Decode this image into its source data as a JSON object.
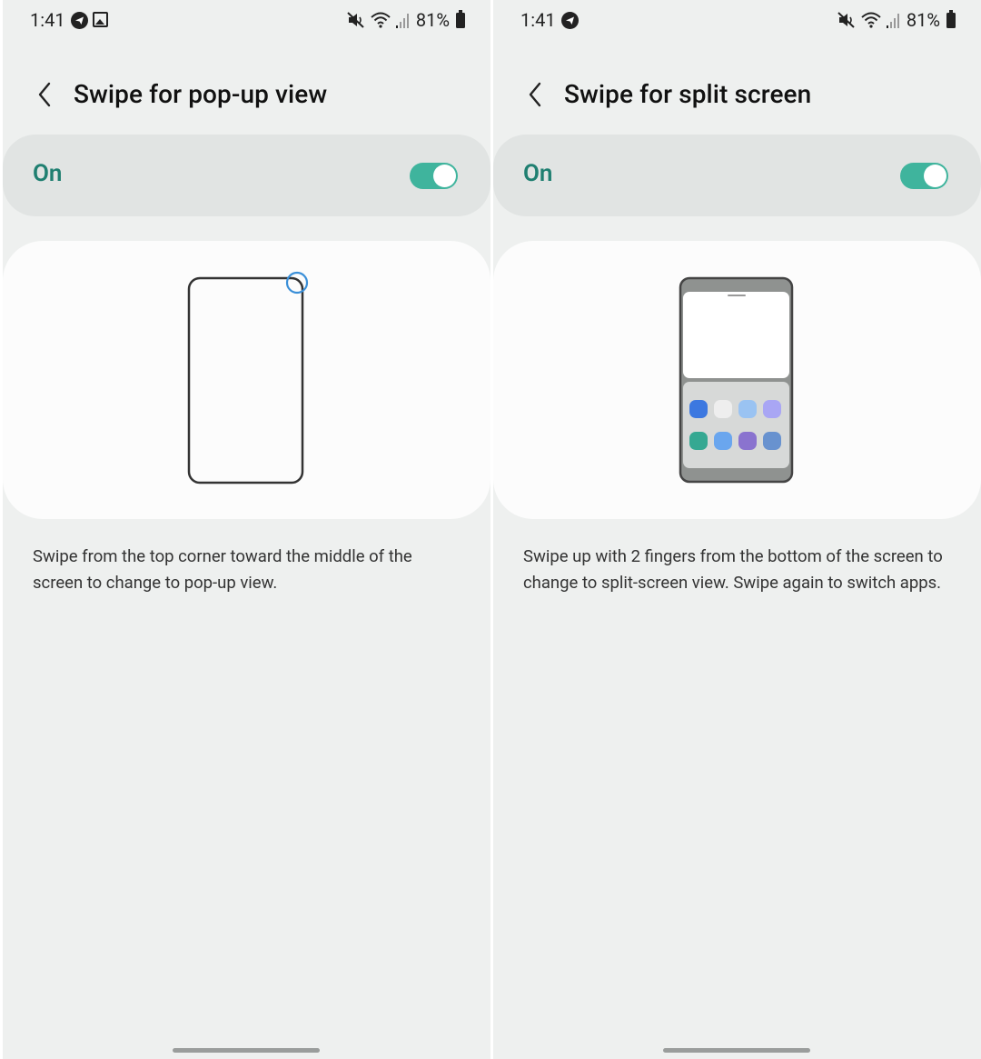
{
  "left_screen": {
    "status": {
      "time": "1:41",
      "left_icons": [
        "telegram-icon",
        "gallery-icon"
      ],
      "right_icons": [
        "mute-icon",
        "wifi-icon",
        "signal-icon"
      ],
      "battery": "81%"
    },
    "title": "Swipe for pop-up view",
    "toggle": {
      "label": "On",
      "state": "on"
    },
    "description": "Swipe from the top corner toward the middle of the screen to change to pop-up view."
  },
  "right_screen": {
    "status": {
      "time": "1:41",
      "left_icons": [
        "telegram-icon"
      ],
      "right_icons": [
        "mute-icon",
        "wifi-icon",
        "signal-icon"
      ],
      "battery": "81%"
    },
    "title": "Swipe for split screen",
    "toggle": {
      "label": "On",
      "state": "on"
    },
    "description": "Swipe up with 2 fingers from the bottom of the screen to change to split-screen view. Swipe again to switch apps."
  },
  "colors": {
    "background": "#eef0ef",
    "accent": "#1f7f71",
    "switch_on": "#3fb49d",
    "touch_circle": "#3a8fd8"
  }
}
